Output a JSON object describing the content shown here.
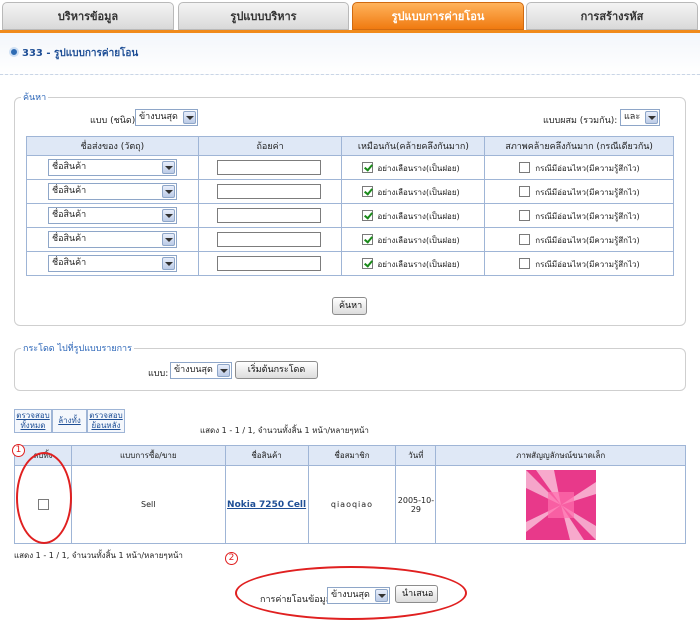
{
  "tabs": [
    {
      "label": "บริหารข้อมูล",
      "active": false
    },
    {
      "label": "รูปแบบบริหาร",
      "active": false
    },
    {
      "label": "รูปแบบการค่ายโอน",
      "active": true
    },
    {
      "label": "การสร้างรหัส",
      "active": false
    }
  ],
  "page_title": "333 - รูปแบบการค่ายโอน",
  "search": {
    "legend": "ค้นหา",
    "type_label": "แบบ (ชนิด):",
    "type_value": "ข้างบนสุด",
    "combine_label": "แบบผสม (รวมกัน):",
    "combine_value": "และ",
    "headers": [
      "ชื่อส่งของ (วัตถุ)",
      "ถ้อยค่า",
      "เหมือนกัน(คล้ายคลึงกันมาก)",
      "สภาพคล้ายคลึงกันมาก (กรณีเดียวกัน)"
    ],
    "rows": [
      {
        "field": "ชื่อสินค้า",
        "value": "",
        "similar_checked": true,
        "similar_label": "อย่างเลือนราง(เป็นฝอย)",
        "sensitive_checked": false,
        "sensitive_label": "กรณีมีอ่อนไหว(มีความรู้สึกไว)"
      },
      {
        "field": "ชื่อสินค้า",
        "value": "",
        "similar_checked": true,
        "similar_label": "อย่างเลือนราง(เป็นฝอย)",
        "sensitive_checked": false,
        "sensitive_label": "กรณีมีอ่อนไหว(มีความรู้สึกไว)"
      },
      {
        "field": "ชื่อสินค้า",
        "value": "",
        "similar_checked": true,
        "similar_label": "อย่างเลือนราง(เป็นฝอย)",
        "sensitive_checked": false,
        "sensitive_label": "กรณีมีอ่อนไหว(มีความรู้สึกไว)"
      },
      {
        "field": "ชื่อสินค้า",
        "value": "",
        "similar_checked": true,
        "similar_label": "อย่างเลือนราง(เป็นฝอย)",
        "sensitive_checked": false,
        "sensitive_label": "กรณีมีอ่อนไหว(มีความรู้สึกไว)"
      },
      {
        "field": "ชื่อสินค้า",
        "value": "",
        "similar_checked": true,
        "similar_label": "อย่างเลือนราง(เป็นฝอย)",
        "sensitive_checked": false,
        "sensitive_label": "กรณีมีอ่อนไหว(มีความรู้สึกไว)"
      }
    ],
    "button": "ค้นหา"
  },
  "jump": {
    "legend": "กระโดด ไปที่รูปแบบรายการ",
    "label": "แบบ:",
    "value": "ข้างบนสุด",
    "button": "เริ่มต้นกระโดด"
  },
  "actions": [
    {
      "line1": "ตรวจสอบ",
      "line2": "ทั้งหมด"
    },
    {
      "line1": "ล้างทั้ง",
      "line2": ""
    },
    {
      "line1": "ตรวจสอบ",
      "line2": "ย้อนหลัง"
    }
  ],
  "pagination_top": "แสดง 1 - 1 / 1,  จำนวนทั้งสิ้น 1 หน้า/หลายๆหน้า",
  "pagination_bottom": "แสดง 1 - 1 / 1,  จำนวนทั้งสิ้น 1 หน้า/หลายๆหน้า",
  "results": {
    "headers": [
      "ลบทิ้ง",
      "แบบการซื้อ/ขาย",
      "ชื่อสินค้า",
      "ชื่อสมาชิก",
      "วันที่",
      "ภาพสัญญลักษณ์ขนาดเล็ก"
    ],
    "rows": [
      {
        "checked": false,
        "trade_type": "Sell",
        "product": "Nokia 7250 Cell",
        "member": "qiaoqiao",
        "date": "2005-10-29"
      }
    ]
  },
  "transfer": {
    "label": "การค่ายโอนข้อมูล",
    "value": "ข้างบนสุด",
    "button": "นำเสนอ"
  },
  "annotations": [
    "1",
    "2"
  ],
  "colors": {
    "accent": "#f07a10",
    "header_blue": "#dfe8f6",
    "annotation_red": "#e02020",
    "thumb_pink": "#e8398a"
  }
}
